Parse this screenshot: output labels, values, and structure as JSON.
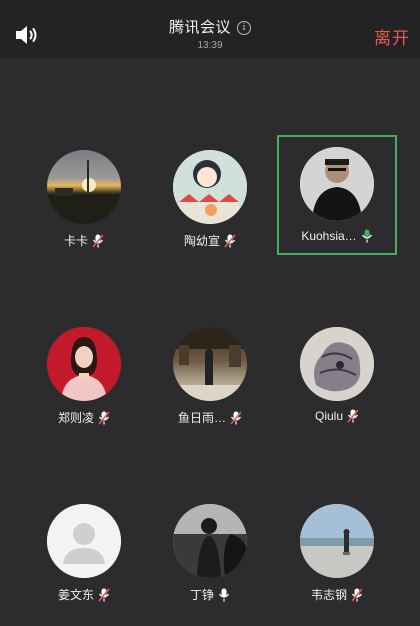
{
  "header": {
    "title": "腾讯会议",
    "time": "13:39",
    "leave_label": "离开",
    "info_glyph": "i",
    "speaker_icon": "speaker-icon"
  },
  "participants": [
    {
      "name": "卡卡",
      "mic": "muted",
      "active": false
    },
    {
      "name": "陶幼宣",
      "mic": "muted",
      "active": false
    },
    {
      "name": "Kuohsia…",
      "mic": "speaking",
      "active": true
    },
    {
      "name": "郑则凌",
      "mic": "muted",
      "active": false
    },
    {
      "name": "鱼日雨…",
      "mic": "muted",
      "active": false
    },
    {
      "name": "Qiulu",
      "mic": "muted",
      "active": false
    },
    {
      "name": "姜文东",
      "mic": "muted",
      "active": false
    },
    {
      "name": "丁铮",
      "mic": "on",
      "active": false
    },
    {
      "name": "韦志钢",
      "mic": "muted",
      "active": false
    }
  ],
  "colors": {
    "background": "#2c2c2e",
    "topbar": "#232325",
    "leave": "#e35a52",
    "active_border": "#43b05c",
    "mic_on": "#ffffff",
    "mic_speaking": "#43b05c",
    "mic_muted_slash": "#e35a52"
  }
}
